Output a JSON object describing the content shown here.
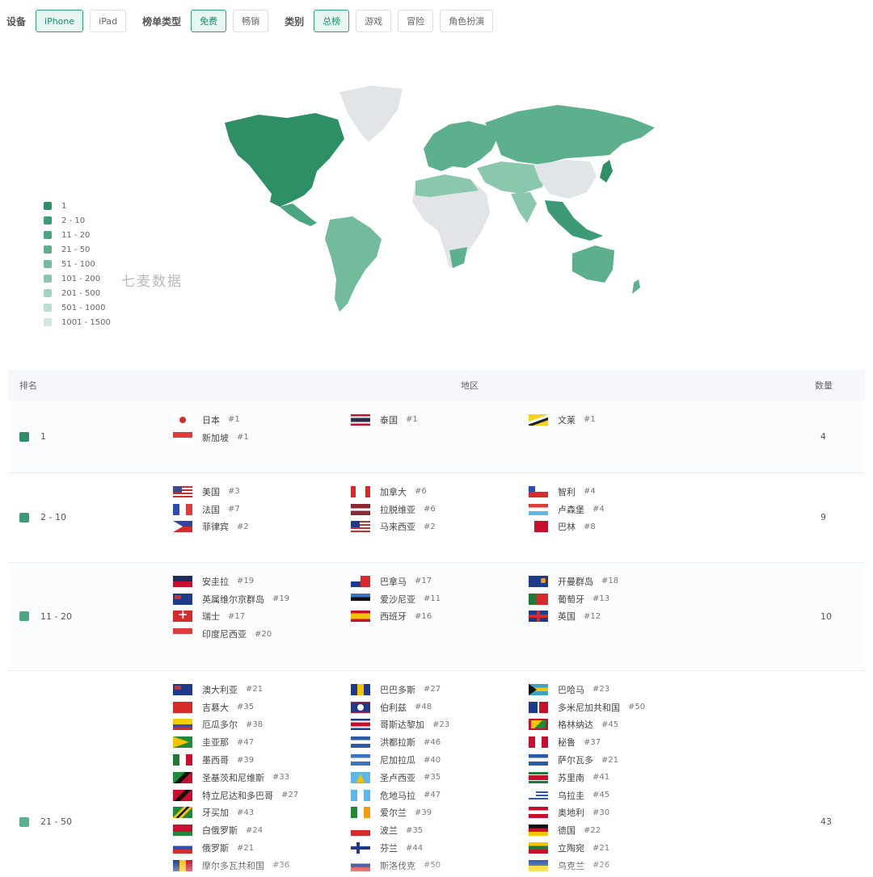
{
  "filters": {
    "device": {
      "label": "设备",
      "options": [
        "iPhone",
        "iPad"
      ],
      "active": 0
    },
    "list_type": {
      "label": "榜单类型",
      "options": [
        "免费",
        "畅销"
      ],
      "active": 0
    },
    "category": {
      "label": "类别",
      "options": [
        "总榜",
        "游戏",
        "冒险",
        "角色扮演"
      ],
      "active": 0
    }
  },
  "watermark": "七麦数据",
  "legend": [
    {
      "label": "1",
      "color": "#2e8f67"
    },
    {
      "label": "2 - 10",
      "color": "#3c9a74"
    },
    {
      "label": "11 - 20",
      "color": "#4aa581"
    },
    {
      "label": "21 - 50",
      "color": "#5cb08e"
    },
    {
      "label": "51 - 100",
      "color": "#72bc9d"
    },
    {
      "label": "101 - 200",
      "color": "#89c8ad"
    },
    {
      "label": "201 - 500",
      "color": "#a1d4be"
    },
    {
      "label": "501 - 1000",
      "color": "#b8dfcf"
    },
    {
      "label": "1001 - 1500",
      "color": "#cfe9df"
    }
  ],
  "map_colors": {
    "top": "#2e8f67",
    "mid": "#5cb08e",
    "low": "#89c8ad",
    "none": "#e2e5e8"
  },
  "table": {
    "headers": {
      "rank": "排名",
      "region": "地区",
      "count": "数量"
    },
    "rows": [
      {
        "rank": "1",
        "color": "#2e8f67",
        "count": "4",
        "cols": [
          [
            {
              "flag": "jp",
              "name": "日本",
              "rk": "#1"
            },
            {
              "flag": "sg",
              "name": "新加坡",
              "rk": "#1"
            }
          ],
          [
            {
              "flag": "th",
              "name": "泰国",
              "rk": "#1"
            }
          ],
          [
            {
              "flag": "bn",
              "name": "文莱",
              "rk": "#1"
            }
          ]
        ]
      },
      {
        "rank": "2 - 10",
        "color": "#3c9a74",
        "count": "9",
        "cols": [
          [
            {
              "flag": "us",
              "name": "美国",
              "rk": "#3"
            },
            {
              "flag": "fr",
              "name": "法国",
              "rk": "#7"
            },
            {
              "flag": "ph",
              "name": "菲律宾",
              "rk": "#2"
            }
          ],
          [
            {
              "flag": "ca",
              "name": "加拿大",
              "rk": "#6"
            },
            {
              "flag": "lv",
              "name": "拉脱维亚",
              "rk": "#6"
            },
            {
              "flag": "my",
              "name": "马来西亚",
              "rk": "#2"
            }
          ],
          [
            {
              "flag": "cl",
              "name": "智利",
              "rk": "#4"
            },
            {
              "flag": "lu",
              "name": "卢森堡",
              "rk": "#4"
            },
            {
              "flag": "bh",
              "name": "巴林",
              "rk": "#8"
            }
          ]
        ]
      },
      {
        "rank": "11 - 20",
        "color": "#4aa581",
        "count": "10",
        "cols": [
          [
            {
              "flag": "ag",
              "name": "安圭拉",
              "rk": "#19"
            },
            {
              "flag": "ky",
              "name": "英属维尔京群岛",
              "rk": "#19"
            },
            {
              "flag": "ch",
              "name": "瑞士",
              "rk": "#17"
            },
            {
              "flag": "id",
              "name": "印度尼西亚",
              "rk": "#20"
            }
          ],
          [
            {
              "flag": "pa",
              "name": "巴拿马",
              "rk": "#17"
            },
            {
              "flag": "ee",
              "name": "爱沙尼亚",
              "rk": "#11"
            },
            {
              "flag": "es",
              "name": "西班牙",
              "rk": "#16"
            }
          ],
          [
            {
              "flag": "ai",
              "name": "开曼群岛",
              "rk": "#18"
            },
            {
              "flag": "pt",
              "name": "葡萄牙",
              "rk": "#13"
            },
            {
              "flag": "gb",
              "name": "英国",
              "rk": "#12"
            }
          ]
        ]
      },
      {
        "rank": "21 - 50",
        "color": "#5cb08e",
        "count": "43",
        "cols": [
          [
            {
              "flag": "au",
              "name": "澳大利亚",
              "rk": "#21"
            },
            {
              "flag": "cn2",
              "name": "吉慕大",
              "rk": "#35"
            },
            {
              "flag": "ec",
              "name": "厄瓜多尔",
              "rk": "#38"
            },
            {
              "flag": "gy",
              "name": "圭亚那",
              "rk": "#47"
            },
            {
              "flag": "mx",
              "name": "墨西哥",
              "rk": "#39"
            },
            {
              "flag": "kn",
              "name": "圣基茨和尼维斯",
              "rk": "#33"
            },
            {
              "flag": "tt",
              "name": "特立尼达和多巴哥",
              "rk": "#27"
            },
            {
              "flag": "jm",
              "name": "牙买加",
              "rk": "#43"
            },
            {
              "flag": "by",
              "name": "白俄罗斯",
              "rk": "#24"
            },
            {
              "flag": "ru",
              "name": "俄罗斯",
              "rk": "#21"
            },
            {
              "flag": "md",
              "name": "摩尔多瓦共和国",
              "rk": "#36"
            }
          ],
          [
            {
              "flag": "bb",
              "name": "巴巴多斯",
              "rk": "#27"
            },
            {
              "flag": "bz",
              "name": "伯利兹",
              "rk": "#48"
            },
            {
              "flag": "cr",
              "name": "哥斯达黎加",
              "rk": "#23"
            },
            {
              "flag": "hn",
              "name": "洪都拉斯",
              "rk": "#46"
            },
            {
              "flag": "ni",
              "name": "尼加拉瓜",
              "rk": "#40"
            },
            {
              "flag": "lc",
              "name": "圣卢西亚",
              "rk": "#35"
            },
            {
              "flag": "gt",
              "name": "危地马拉",
              "rk": "#47"
            },
            {
              "flag": "ie",
              "name": "爱尔兰",
              "rk": "#39"
            },
            {
              "flag": "pl",
              "name": "波兰",
              "rk": "#35"
            },
            {
              "flag": "fi",
              "name": "芬兰",
              "rk": "#44"
            },
            {
              "flag": "sk",
              "name": "斯洛伐克",
              "rk": "#50"
            }
          ],
          [
            {
              "flag": "bs",
              "name": "巴哈马",
              "rk": "#23"
            },
            {
              "flag": "do",
              "name": "多米尼加共和国",
              "rk": "#50"
            },
            {
              "flag": "gd",
              "name": "格林纳达",
              "rk": "#45"
            },
            {
              "flag": "pe",
              "name": "秘鲁",
              "rk": "#37"
            },
            {
              "flag": "sv",
              "name": "萨尔瓦多",
              "rk": "#21"
            },
            {
              "flag": "sr",
              "name": "苏里南",
              "rk": "#41"
            },
            {
              "flag": "uy",
              "name": "乌拉圭",
              "rk": "#45"
            },
            {
              "flag": "at",
              "name": "奥地利",
              "rk": "#30"
            },
            {
              "flag": "de",
              "name": "德国",
              "rk": "#22"
            },
            {
              "flag": "lt",
              "name": "立陶宛",
              "rk": "#21"
            },
            {
              "flag": "ua",
              "name": "乌克兰",
              "rk": "#26"
            }
          ]
        ]
      }
    ]
  }
}
